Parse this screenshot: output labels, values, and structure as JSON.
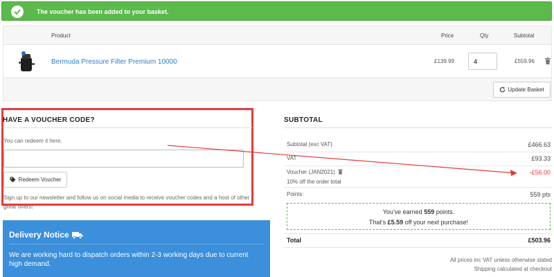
{
  "alert": {
    "message": "The voucher has been added to your basket.",
    "icon": "check-circle-icon",
    "color": "#5cb94b"
  },
  "cart": {
    "headers": {
      "product": "Product",
      "price": "Price",
      "qty": "Qty",
      "subtotal": "Subtotal"
    },
    "items": [
      {
        "name": "Bermuda Pressure Filter Premium 10000",
        "price": "£139.99",
        "qty": "4",
        "subtotal": "£559.96"
      }
    ],
    "update_label": "Update Basket"
  },
  "voucher": {
    "title": "HAVE A VOUCHER CODE?",
    "text": "You can redeem it here.",
    "input_value": "",
    "redeem_label": "Redeem Voucher",
    "signup_text": "Sign up to our newsletter and follow us on social media to receive voucher codes and a host of other great offers!"
  },
  "delivery": {
    "title": "Delivery Notice",
    "text": "We are working hard to dispatch orders within 2-3 working days due to current high demand.",
    "color": "#3b8fdb"
  },
  "summary": {
    "title": "SUBTOTAL",
    "subtotal_label": "Subtotal (exc VAT)",
    "subtotal_value": "£466.63",
    "vat_label": "VAT",
    "vat_value": "£93.33",
    "voucher_label": "Voucher (JAN2021)",
    "voucher_value": "-£56.00",
    "voucher_desc": "10% off the order total",
    "points_label": "Points:",
    "points_value": "559 pts",
    "earned_pre": "You've earned ",
    "earned_points": "559",
    "earned_post": " points.",
    "that_pre": "That's ",
    "that_amount": "£5.59",
    "that_post": " off your next purchase!",
    "total_label": "Total",
    "total_value": "£503.96",
    "note_vat": "All prices inc VAT unless otherwise stated",
    "note_shipping": "Shipping calculated at checkout",
    "negative_color": "#e53a3a"
  },
  "annotation": {
    "box_color": "#e53a3a"
  }
}
